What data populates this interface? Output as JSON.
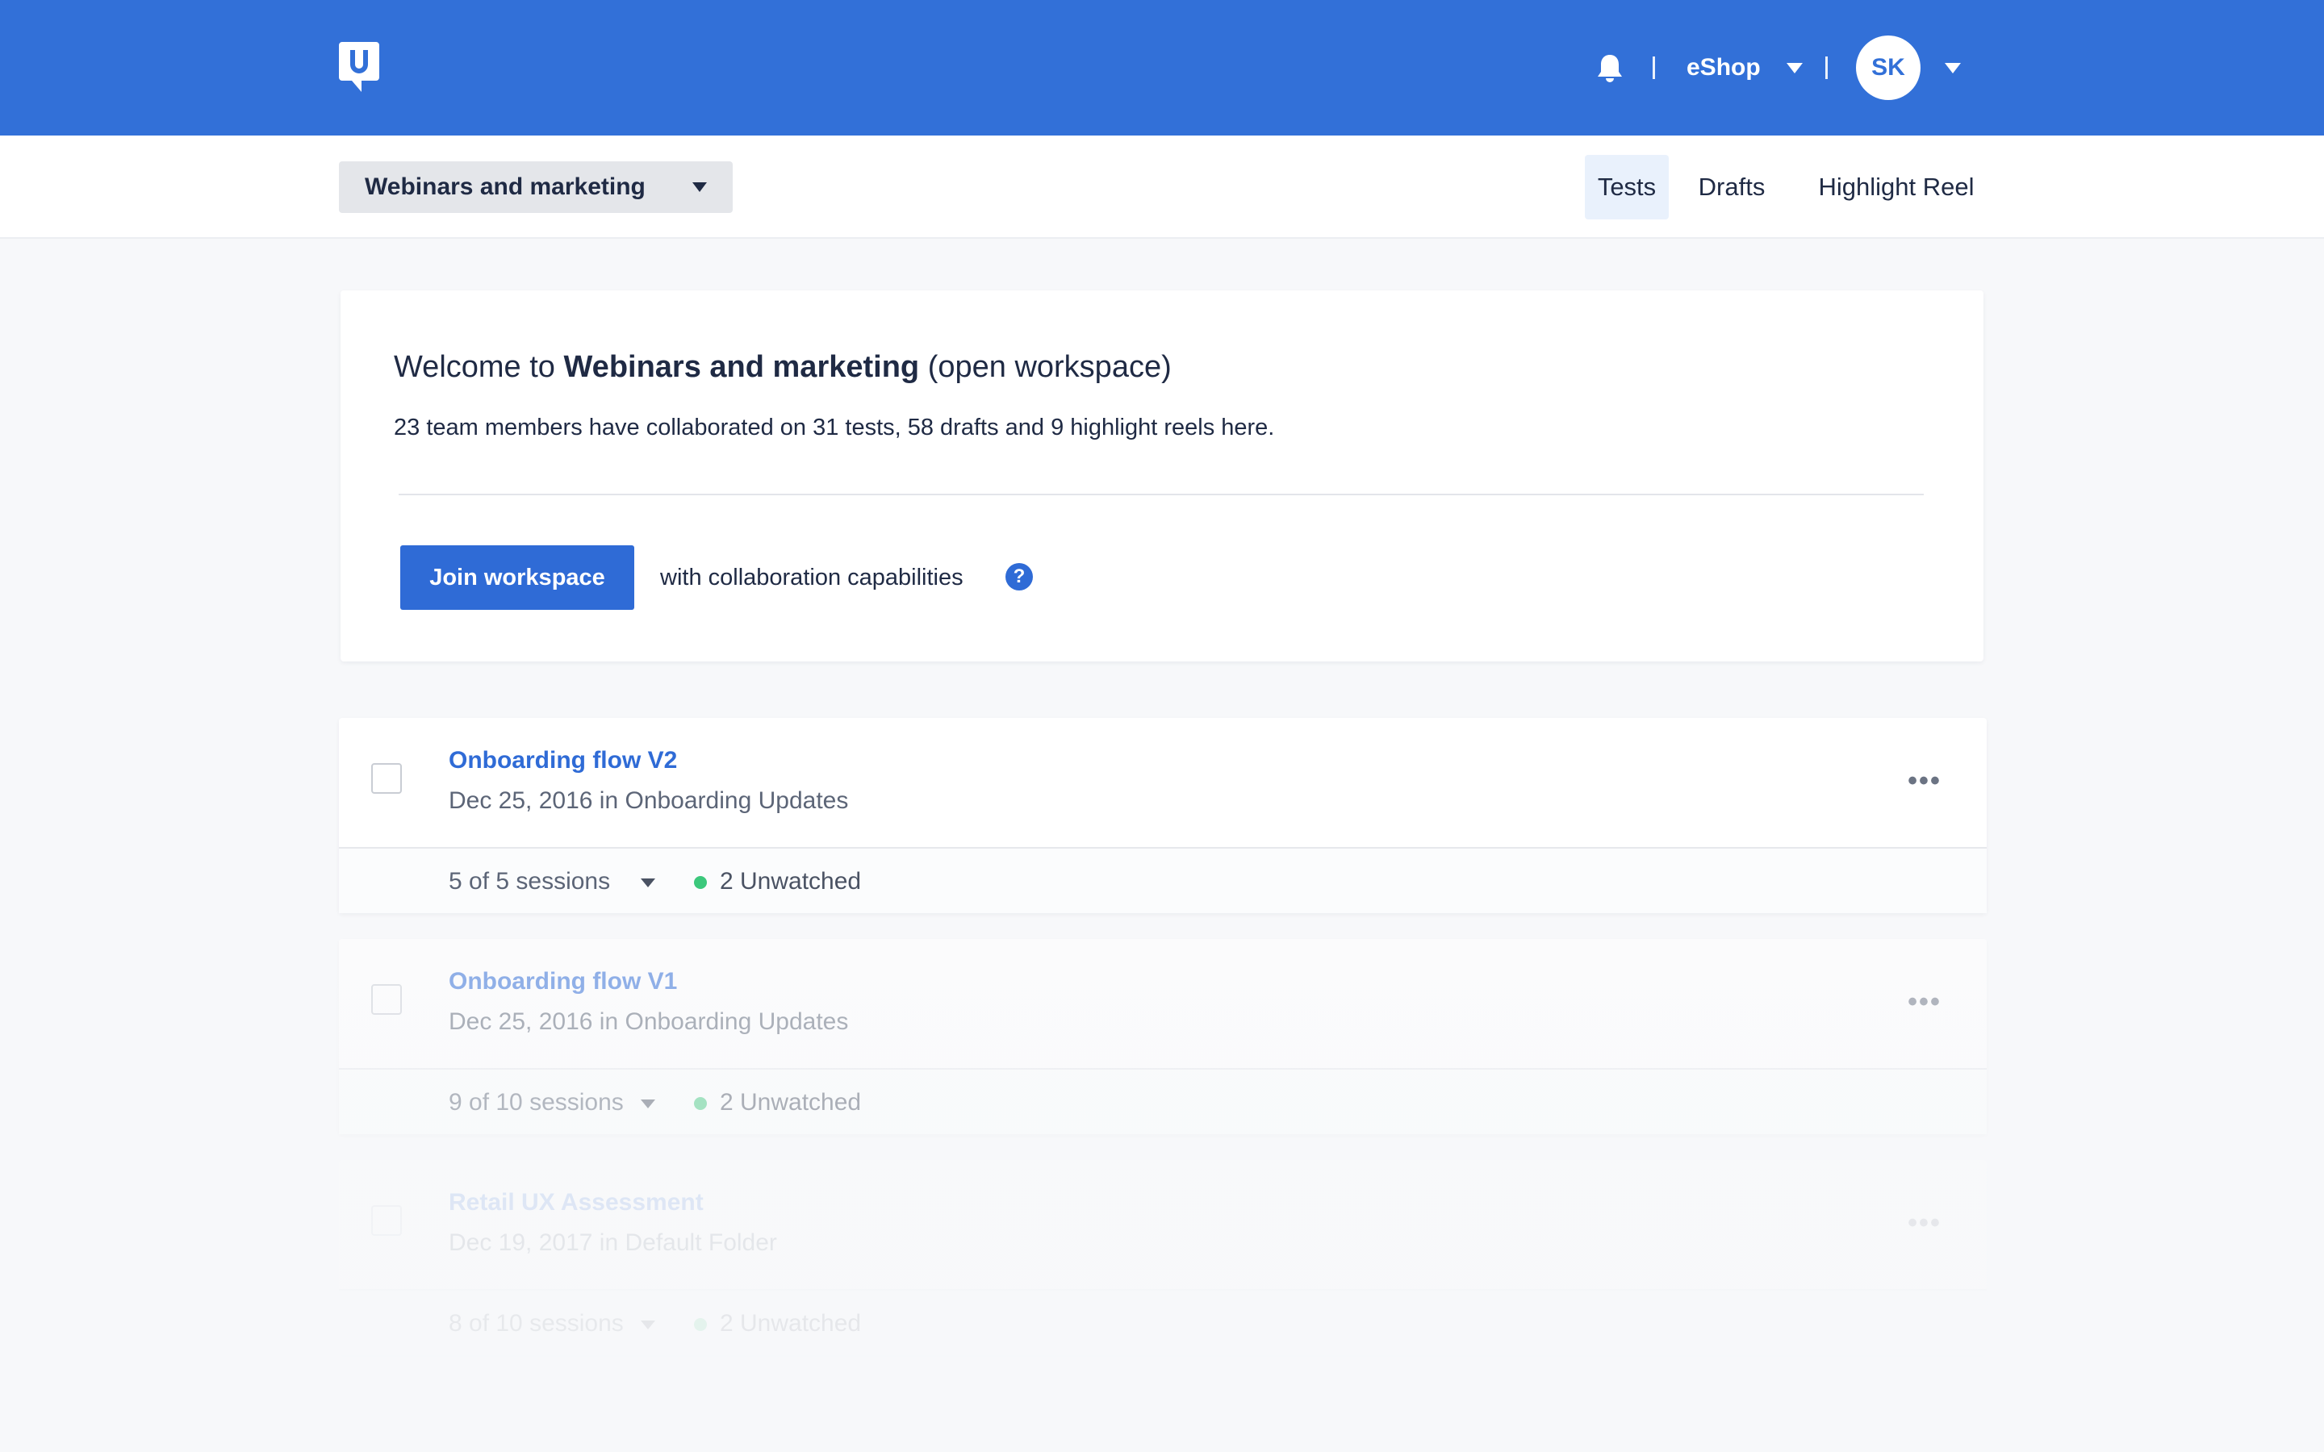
{
  "header": {
    "logo_icon": "usertesting-logo-icon",
    "bell_icon": "bell-icon",
    "account_name": "eShop",
    "avatar_initials": "SK",
    "brand_color": "#3270d8"
  },
  "subnav": {
    "workspace_selector": "Webinars and marketing",
    "tabs": [
      {
        "label": "Tests",
        "active": true
      },
      {
        "label": "Drafts",
        "active": false
      },
      {
        "label": "Highlight Reel",
        "active": false
      }
    ]
  },
  "welcome": {
    "title_prefix": "Welcome to",
    "workspace_name": "Webinars and marketing",
    "title_suffix": "(open workspace)",
    "description": "23 team members have collaborated on 31 tests, 58 drafts and 9 highlight reels here.",
    "join_button": "Join workspace",
    "collab_text": "with collaboration capabilities",
    "help_icon": "?"
  },
  "tests": [
    {
      "title": "Onboarding flow V2",
      "meta": "Dec 25, 2016 in Onboarding Updates",
      "sessions": "5 of 5 sessions",
      "unwatched": "2 Unwatched",
      "more": "•••"
    },
    {
      "title": "Onboarding flow V1",
      "meta": "Dec 25, 2016 in Onboarding Updates",
      "sessions": "9 of 10 sessions",
      "unwatched": "2 Unwatched",
      "more": "•••"
    },
    {
      "title": "Retail UX Assessment",
      "meta": "Dec 19, 2017 in Default Folder",
      "sessions": "8 of 10 sessions",
      "unwatched": "2 Unwatched",
      "more": "•••"
    }
  ]
}
